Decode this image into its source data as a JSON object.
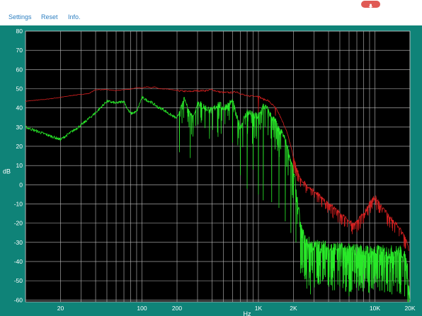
{
  "toolbar": {
    "settings_label": "Settings",
    "reset_label": "Reset",
    "info_label": "Info.",
    "mic_icon": "microphone-icon",
    "mic_color": "#e05a55",
    "link_color": "#2d7fc1"
  },
  "theme": {
    "panel_color": "#0f8378",
    "plot_background": "#000000",
    "grid_color": "#bfbfbf"
  },
  "chart_data": {
    "type": "line",
    "xlabel": "Hz",
    "ylabel": "dB",
    "x_scale": "log",
    "xlim": [
      10,
      20000
    ],
    "ylim": [
      -61,
      80
    ],
    "grid": true,
    "x_ticks": [
      {
        "value": 20,
        "label": "20"
      },
      {
        "value": 100,
        "label": "100"
      },
      {
        "value": 200,
        "label": "200"
      },
      {
        "value": 1000,
        "label": "1K"
      },
      {
        "value": 2000,
        "label": "2K"
      },
      {
        "value": 10000,
        "label": "10K"
      },
      {
        "value": 20000,
        "label": "20K"
      }
    ],
    "y_ticks": [
      80,
      70,
      60,
      50,
      40,
      30,
      20,
      10,
      0,
      -10,
      -20,
      -30,
      -40,
      -50,
      -60
    ],
    "series": [
      {
        "color": "#d42020",
        "points": [
          [
            10,
            43.5
          ],
          [
            15,
            44.5
          ],
          [
            20,
            45.5
          ],
          [
            25,
            46.5
          ],
          [
            30,
            47
          ],
          [
            35,
            47.5
          ],
          [
            40,
            49.5
          ],
          [
            50,
            49.5
          ],
          [
            60,
            49
          ],
          [
            70,
            49.5
          ],
          [
            80,
            49.8
          ],
          [
            90,
            50.5
          ],
          [
            100,
            50.5
          ],
          [
            110,
            51
          ],
          [
            120,
            50.5
          ],
          [
            130,
            51
          ],
          [
            140,
            50
          ],
          [
            150,
            50
          ],
          [
            180,
            49.5
          ],
          [
            200,
            49
          ],
          [
            250,
            48.5
          ],
          [
            300,
            49
          ],
          [
            350,
            49
          ],
          [
            400,
            49.5
          ],
          [
            450,
            48.5
          ],
          [
            500,
            48
          ],
          [
            550,
            48
          ],
          [
            600,
            48
          ],
          [
            650,
            48.5
          ],
          [
            700,
            47.5
          ],
          [
            800,
            46
          ],
          [
            900,
            46.5
          ],
          [
            1000,
            46
          ],
          [
            1100,
            44.5
          ],
          [
            1200,
            44
          ],
          [
            1300,
            42
          ],
          [
            1400,
            40
          ],
          [
            1500,
            37
          ],
          [
            1600,
            33
          ],
          [
            1700,
            30
          ],
          [
            1800,
            25
          ],
          [
            1900,
            20
          ],
          [
            2000,
            14
          ],
          [
            2100,
            10
          ],
          [
            2200,
            6
          ],
          [
            2300,
            3
          ],
          [
            2500,
            1
          ],
          [
            2700,
            -1
          ],
          [
            3000,
            -3
          ],
          [
            3300,
            -5
          ],
          [
            3600,
            -8
          ],
          [
            4000,
            -10
          ],
          [
            4500,
            -12
          ],
          [
            5000,
            -15
          ],
          [
            5500,
            -17
          ],
          [
            6000,
            -19
          ],
          [
            6500,
            -20
          ],
          [
            7000,
            -19
          ],
          [
            7500,
            -17
          ],
          [
            8000,
            -15
          ],
          [
            8500,
            -12
          ],
          [
            9000,
            -9
          ],
          [
            9500,
            -8
          ],
          [
            10000,
            -6
          ],
          [
            10500,
            -8
          ],
          [
            11000,
            -10
          ],
          [
            12000,
            -13
          ],
          [
            13000,
            -16
          ],
          [
            14000,
            -18
          ],
          [
            15000,
            -20
          ],
          [
            16000,
            -22
          ],
          [
            17000,
            -24
          ],
          [
            18000,
            -27
          ],
          [
            19000,
            -31
          ],
          [
            19500,
            -34
          ]
        ],
        "dips": [
          [
            1000,
            38
          ],
          [
            1400,
            36
          ],
          [
            2000,
            6
          ],
          [
            2300,
            -1
          ],
          [
            3200,
            -9
          ],
          [
            4200,
            -15
          ],
          [
            5800,
            -22
          ],
          [
            6800,
            -23
          ],
          [
            8000,
            -20
          ]
        ]
      },
      {
        "color": "#29e829",
        "points": [
          [
            10,
            30
          ],
          [
            20,
            23.5
          ],
          [
            30,
            31
          ],
          [
            40,
            37.5
          ],
          [
            50,
            43.5
          ],
          [
            60,
            42.5
          ],
          [
            70,
            43.5
          ],
          [
            75,
            39.5
          ],
          [
            80,
            37
          ],
          [
            90,
            38
          ],
          [
            100,
            45.5
          ],
          [
            110,
            44
          ],
          [
            120,
            43
          ],
          [
            140,
            40
          ],
          [
            150,
            39.5
          ],
          [
            170,
            37
          ],
          [
            200,
            34.5
          ],
          [
            230,
            45
          ],
          [
            260,
            37
          ],
          [
            280,
            36
          ],
          [
            300,
            43
          ],
          [
            350,
            40
          ],
          [
            400,
            38.5
          ],
          [
            450,
            42
          ],
          [
            500,
            40
          ],
          [
            550,
            41.5
          ],
          [
            600,
            43.5
          ],
          [
            650,
            35
          ],
          [
            700,
            30
          ],
          [
            800,
            38
          ],
          [
            900,
            36
          ],
          [
            1000,
            35.5
          ],
          [
            1100,
            41
          ],
          [
            1200,
            39
          ],
          [
            1300,
            35
          ],
          [
            1400,
            33
          ],
          [
            1500,
            28
          ],
          [
            1600,
            27
          ],
          [
            1700,
            23
          ],
          [
            1800,
            18
          ],
          [
            1900,
            12
          ],
          [
            2000,
            7
          ],
          [
            2100,
            -3
          ],
          [
            2200,
            -13
          ],
          [
            2300,
            -22
          ],
          [
            2500,
            -29
          ],
          [
            2800,
            -31
          ],
          [
            3000,
            -32
          ],
          [
            3500,
            -32
          ],
          [
            4000,
            -33
          ],
          [
            4500,
            -33
          ],
          [
            5000,
            -33.5
          ],
          [
            6000,
            -34
          ],
          [
            7000,
            -34
          ],
          [
            8000,
            -34.5
          ],
          [
            9000,
            -35
          ],
          [
            10000,
            -34.5
          ],
          [
            11000,
            -35
          ],
          [
            12000,
            -35
          ],
          [
            14000,
            -35
          ],
          [
            16000,
            -35
          ],
          [
            17000,
            -35
          ],
          [
            18000,
            -38
          ],
          [
            19000,
            -42
          ],
          [
            19500,
            -53
          ],
          [
            20000,
            -58
          ]
        ],
        "dips": [
          [
            210,
            17
          ],
          [
            260,
            14
          ],
          [
            380,
            24
          ],
          [
            450,
            25
          ],
          [
            600,
            22
          ],
          [
            700,
            5
          ],
          [
            800,
            -2
          ],
          [
            900,
            8
          ],
          [
            1000,
            -5
          ],
          [
            1100,
            -8
          ],
          [
            1300,
            -9
          ],
          [
            1500,
            -12
          ],
          [
            1700,
            -19
          ],
          [
            1900,
            -25
          ],
          [
            2100,
            -30
          ],
          [
            2300,
            -46
          ],
          [
            2400,
            -40
          ],
          [
            2600,
            -54
          ],
          [
            2800,
            -57
          ],
          [
            3000,
            -51
          ],
          [
            3300,
            -52
          ],
          [
            3600,
            -49
          ],
          [
            4000,
            -44
          ],
          [
            4500,
            -50
          ],
          [
            5000,
            -53
          ],
          [
            5500,
            -47
          ],
          [
            6000,
            -58
          ],
          [
            6700,
            -49
          ],
          [
            7500,
            -52
          ],
          [
            8500,
            -47
          ],
          [
            9500,
            -54
          ],
          [
            10500,
            -49
          ],
          [
            11500,
            -55
          ],
          [
            12500,
            -52
          ],
          [
            14000,
            -57
          ],
          [
            15000,
            -51
          ],
          [
            16500,
            -55
          ],
          [
            18000,
            -58
          ],
          [
            19500,
            -61
          ]
        ]
      }
    ]
  }
}
